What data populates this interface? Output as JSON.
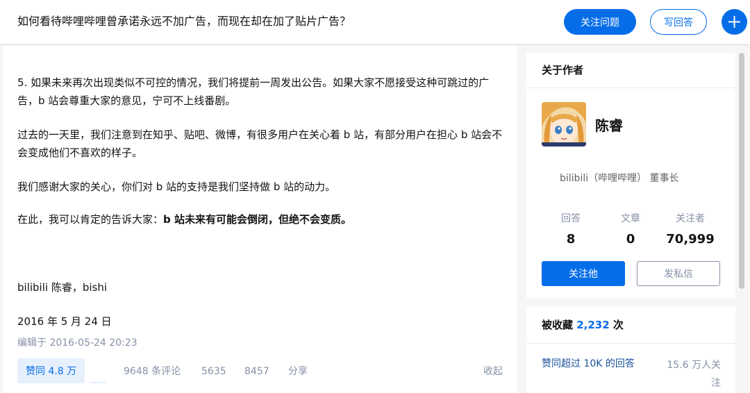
{
  "header": {
    "question_title": "如何看待哔哩哔哩曾承诺永远不加广告，而现在却在加了贴片广告？",
    "follow_question_label": "关注问题",
    "write_answer_label": "写回答"
  },
  "answer": {
    "paragraphs": {
      "p1": "5.   如果未来再次出现类似不可控的情况，我们将提前一周发出公告。如果大家不愿接受这种可跳过的广告，b 站会尊重大家的意见，宁可不上线番剧。",
      "p2": "过去的一天里，我们注意到在知乎、贴吧、微博，有很多用户在关心着 b 站，有部分用户在担心 b 站会不会变成他们不喜欢的样子。",
      "p3": "我们感谢大家的关心，你们对 b 站的支持是我们坚持做 b 站的动力。",
      "p4_prefix": "在此，我可以肯定的告诉大家：",
      "p4_bold": "b 站未来有可能会倒闭，但绝不会变质。",
      "p5": "bilibili 陈睿，bishi",
      "p6": "2016 年 5 月 24 日"
    },
    "edited": "编辑于 2016-05-24 20:23",
    "actions": {
      "vote_label": "赞同 4.8 万",
      "comments": "9648 条评论",
      "stat1": "5635",
      "stat2": "8457",
      "share": "分享",
      "collapse": "收起"
    }
  },
  "author_card": {
    "title": "关于作者",
    "name": "陈睿",
    "description": "bilibili（哔哩哔哩） 董事长",
    "stats": [
      {
        "label": "回答",
        "value": "8"
      },
      {
        "label": "文章",
        "value": "0"
      },
      {
        "label": "关注者",
        "value": "70,999"
      }
    ],
    "follow_label": "关注他",
    "message_label": "发私信"
  },
  "collect_card": {
    "prefix": "被收藏 ",
    "count": "2,232",
    "suffix": " 次",
    "badge_title": "赞同超过 10K 的回答",
    "badge_count": "15.6 万人关注"
  },
  "colors": {
    "accent": "#056de8",
    "muted": "#8590a6"
  }
}
